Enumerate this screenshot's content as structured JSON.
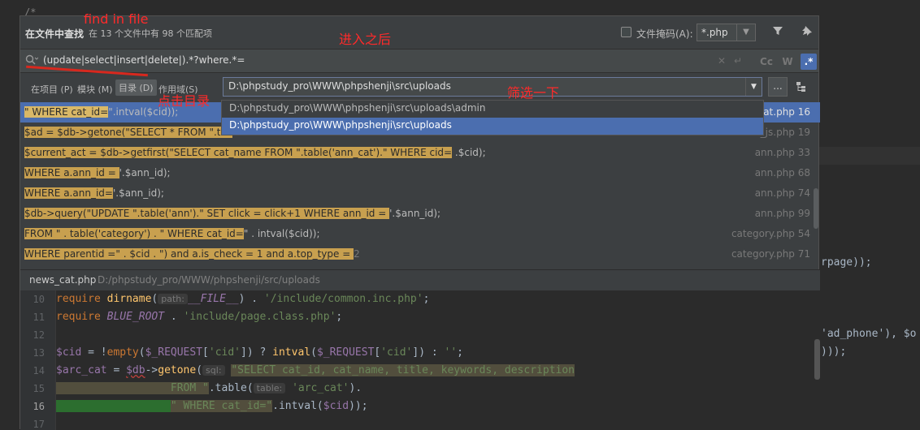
{
  "background": {
    "top_snippet": "/*",
    "lines": [
      "rpage));",
      "'ad_phone'), $o",
      ")));"
    ]
  },
  "dialog": {
    "title": "在文件中查找",
    "summary": "在 13 个文件中有 98 个匹配项",
    "file_mask_label": "文件掩码(A):",
    "file_mask_value": "*.php"
  },
  "search": {
    "query": "(update|select|insert|delete|).*?where.*=",
    "case_btn": "Cc",
    "word_btn": "W",
    "regex_btn": ".*"
  },
  "scope": {
    "tabs": [
      "在项目 (P)",
      "模块 (M)",
      "目录 (D)",
      "作用域(S)"
    ],
    "active_tab": "目录 (D)",
    "directory": "D:\\phpstudy_pro\\WWW\\phpshenji\\src\\uploads",
    "browse": "...",
    "dropdown_options": [
      "D:\\phpstudy_pro\\WWW\\phpshenji\\src\\uploads\\admin",
      "D:\\phpstudy_pro\\WWW\\phpshenji\\src\\uploads"
    ]
  },
  "results": [
    {
      "pre": "",
      "match": "\" WHERE cat_id=",
      "post": "\".intval($cid));",
      "file": "at.php 16"
    },
    {
      "pre": "",
      "match": "$ad = $db->getone(\"SELECT * FROM \".tab",
      "post": "",
      "file": "ad_js.php 19"
    },
    {
      "pre": "",
      "match": "$current_act = $db->getfirst(\"SELECT cat_name FROM \".table('ann_cat').\" WHERE cid=",
      "post": " .$cid);",
      "file": "ann.php 33"
    },
    {
      "pre": "",
      "match": "WHERE a.ann_id = ",
      "post": "'.$ann_id);",
      "file": "ann.php 68"
    },
    {
      "pre": "",
      "match": " WHERE a.ann_id=",
      "post": "'.$ann_id);",
      "file": "ann.php 74"
    },
    {
      "pre": "",
      "match": "$db->query(\"UPDATE \".table('ann').\" SET click = click+1 WHERE ann_id = ",
      "post": "'.$ann_id);",
      "file": "ann.php 99"
    },
    {
      "pre": "",
      "match": " FROM \" . table('category') . \" WHERE cat_id=",
      "post": "\" . intval($cid));",
      "file": "category.php 54"
    },
    {
      "pre": "",
      "match": "WHERE parentid =\" . $cid . \") and a.is_check = 1 and a.top_type = ",
      "post": "2",
      "file": "category.php 71"
    }
  ],
  "preview": {
    "file_name": "news_cat.php",
    "path": "D:/phpstudy_pro/WWW/phpshenji/src/uploads",
    "line_numbers": [
      "10",
      "11",
      "12",
      "13",
      "14",
      "15",
      "16",
      "17"
    ],
    "code": {
      "l10_kw": "require",
      "l10_fn": "dirname",
      "l10_hint": "path:",
      "l10_const": "__FILE__",
      "l10_rest": ") . ",
      "l10_str": "'/include/common.inc.php'",
      "l10_end": ";",
      "l11_kw": "require",
      "l11_const": "BLUE_ROOT",
      "l11_mid": " . ",
      "l11_str": "'include/page.class.php'",
      "l11_end": ";",
      "l13_var1": "$cid",
      "l13_a": " = !",
      "l13_fn1": "empty",
      "l13_b": "(",
      "l13_var2": "$_REQUEST",
      "l13_c": "[",
      "l13_str1": "'cid'",
      "l13_d": "]) ? ",
      "l13_fn2": "intval",
      "l13_e": "(",
      "l13_var3": "$_REQUEST",
      "l13_f": "[",
      "l13_str2": "'cid'",
      "l13_g": "]) : ",
      "l13_str3": "''",
      "l13_h": ";",
      "l14_var1": "$arc_cat",
      "l14_a": " = ",
      "l14_var2": "$db",
      "l14_b": "->",
      "l14_fn": "getone",
      "l14_c": "(",
      "l14_hint": "sql:",
      "l14_str": "\"SELECT cat_id, cat_name, title, keywords, description",
      "l15_str": "FROM \"",
      "l15_a": ".table(",
      "l15_hint": "table:",
      "l15_str2": "'arc_cat'",
      "l15_b": ").",
      "l16_str": "\" WHERE cat_id=\"",
      "l16_a": ".intval(",
      "l16_var": "$cid",
      "l16_b": "));"
    }
  },
  "annotations": {
    "find_in_file": "find in file",
    "after_enter": "进入之后",
    "click_dir": "点击目录",
    "filter": "筛选一下"
  },
  "colors": {
    "accent": "#4b6eaf",
    "annotation": "#ff2a2a",
    "match_highlight": "#c8a04f"
  }
}
